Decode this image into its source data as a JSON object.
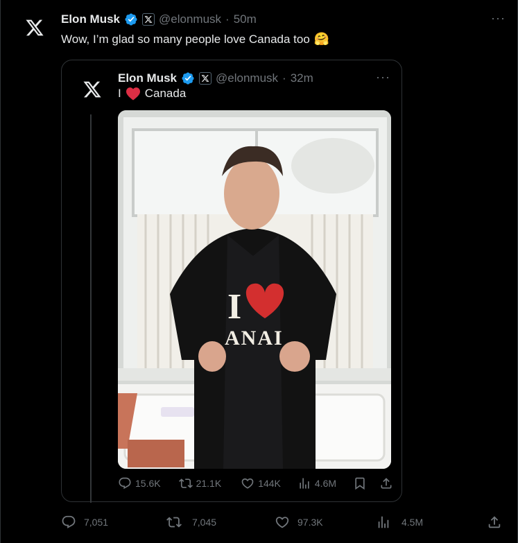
{
  "tweet": {
    "author_name": "Elon Musk",
    "handle": "@elonmusk",
    "separator": "·",
    "time": "50m",
    "text": "Wow, I’m glad so many people love Canada too",
    "emoji": "🤗",
    "more": "···",
    "stats": {
      "replies": "7,051",
      "reposts": "7,045",
      "likes": "97.3K",
      "views": "4.5M"
    }
  },
  "quoted": {
    "author_name": "Elon Musk",
    "handle": "@elonmusk",
    "separator": "·",
    "time": "32m",
    "text_before": "I",
    "text_after": "Canada",
    "more": "···",
    "photo": {
      "shirt_text_top": "I",
      "shirt_text_bottom": "ANAI"
    },
    "stats": {
      "replies": "15.6K",
      "reposts": "21.1K",
      "likes": "144K",
      "views": "4.6M"
    }
  },
  "colors": {
    "background": "#000000",
    "text": "#e7e9ea",
    "muted": "#71767b",
    "verified": "#1d9bf0",
    "heart": "#e0245e"
  },
  "icons": [
    "x-logo-icon",
    "verified-badge-icon",
    "affiliate-x-icon",
    "more-icon",
    "reply-icon",
    "repost-icon",
    "like-icon",
    "views-icon",
    "bookmark-icon",
    "share-icon"
  ]
}
